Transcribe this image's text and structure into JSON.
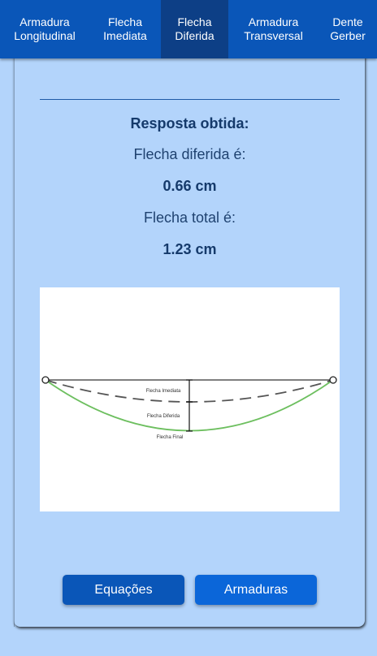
{
  "tabs": [
    {
      "label": "Armadura\nLongitudinal",
      "active": false
    },
    {
      "label": "Flecha\nImediata",
      "active": false
    },
    {
      "label": "Flecha\nDiferida",
      "active": true
    },
    {
      "label": "Armadura\nTransversal",
      "active": false
    },
    {
      "label": "Dente\nGerber",
      "active": false
    }
  ],
  "result": {
    "title": "Resposta obtida:",
    "deferred_label": "Flecha diferida é:",
    "deferred_value": "0.66 cm",
    "total_label": "Flecha total é:",
    "total_value": "1.23 cm"
  },
  "diagram": {
    "immediate_label": "Flecha Imediata",
    "deferred_label": "Flecha Diferida",
    "final_label": "Flecha Final",
    "colors": {
      "final_curve": "#6dbf5f",
      "immediate_curve": "#555555",
      "beam": "#333333"
    }
  },
  "buttons": {
    "equations": "Equações",
    "reinforcements": "Armaduras"
  }
}
